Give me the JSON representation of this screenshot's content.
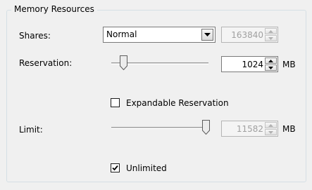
{
  "group": {
    "title": "Memory Resources"
  },
  "shares": {
    "label": "Shares:",
    "level": "Normal",
    "value": "163840"
  },
  "reservation": {
    "label": "Reservation:",
    "value": "1024",
    "unit": "MB",
    "slider_fraction": 0.12
  },
  "expandable": {
    "label": "Expandable Reservation",
    "checked": false
  },
  "limit": {
    "label": "Limit:",
    "value": "11582",
    "unit": "MB",
    "slider_fraction": 1.0
  },
  "unlimited": {
    "label": "Unlimited",
    "checked": true
  },
  "icons": {
    "dropdown": "chevron-down-icon",
    "spin_up": "arrow-up-icon",
    "spin_down": "arrow-down-icon",
    "check": "checkmark-icon"
  },
  "colors": {
    "background": "#f0f0f0",
    "disabled_text": "#a0a0a0",
    "group_border": "#d5dfe5"
  }
}
